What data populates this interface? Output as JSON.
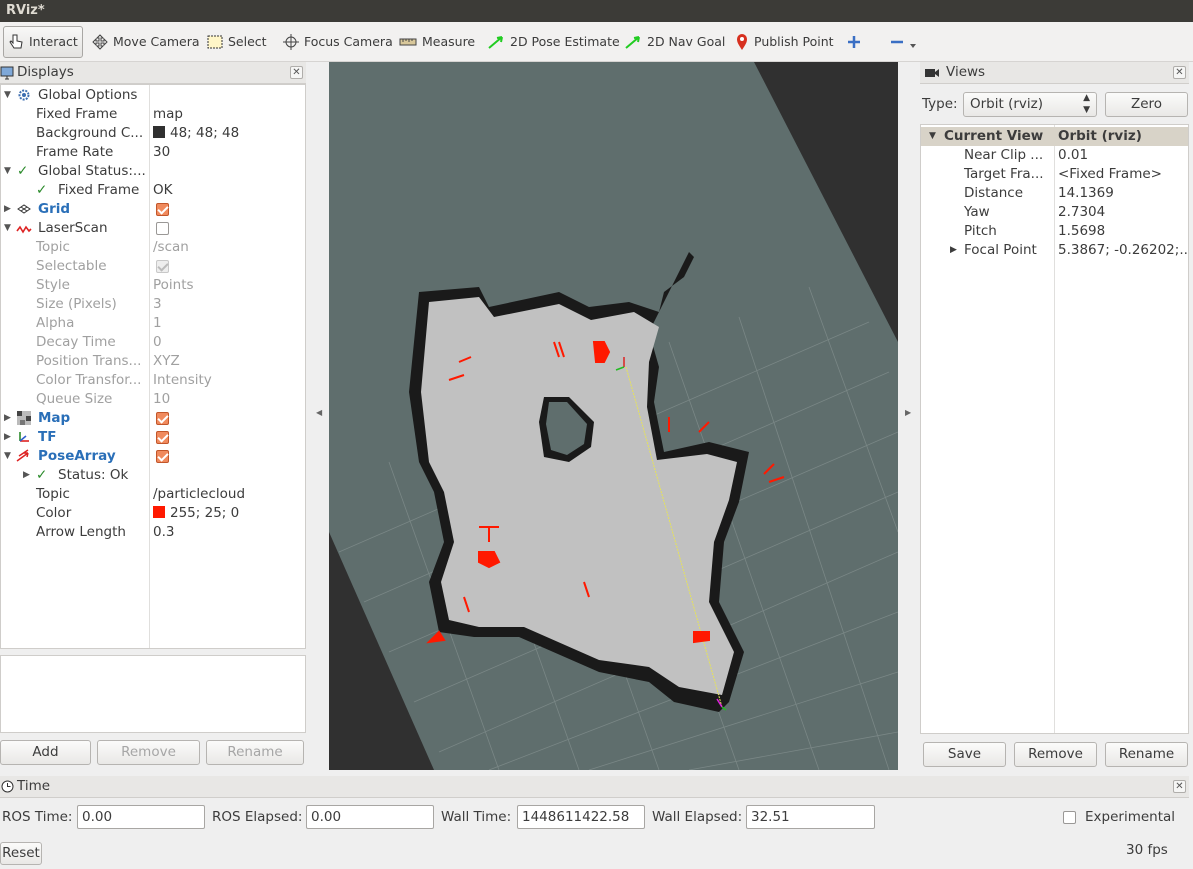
{
  "window": {
    "title": "RViz*"
  },
  "toolbar": {
    "interact": "Interact",
    "move_camera": "Move Camera",
    "select": "Select",
    "focus_camera": "Focus Camera",
    "measure": "Measure",
    "pose_estimate": "2D Pose Estimate",
    "nav_goal": "2D Nav Goal",
    "publish_point": "Publish Point"
  },
  "displays": {
    "title": "Displays",
    "rows": {
      "global_options": "Global Options",
      "fixed_frame": {
        "name": "Fixed Frame",
        "value": "map"
      },
      "background_color": {
        "name": "Background C...",
        "value": "48; 48; 48",
        "color": "#303030"
      },
      "frame_rate": {
        "name": "Frame Rate",
        "value": "30"
      },
      "global_status": "Global Status:...",
      "fixed_frame_status": {
        "name": "Fixed Frame",
        "value": "OK"
      },
      "grid": "Grid",
      "laserscan": "LaserScan",
      "topic": {
        "name": "Topic",
        "value": "/scan"
      },
      "selectable": "Selectable",
      "style": {
        "name": "Style",
        "value": "Points"
      },
      "size": {
        "name": "Size (Pixels)",
        "value": "3"
      },
      "alpha": {
        "name": "Alpha",
        "value": "1"
      },
      "decay": {
        "name": "Decay Time",
        "value": "0"
      },
      "position_transformer": {
        "name": "Position Trans...",
        "value": "XYZ"
      },
      "color_transformer": {
        "name": "Color Transfor...",
        "value": "Intensity"
      },
      "queue_size": {
        "name": "Queue Size",
        "value": "10"
      },
      "map": "Map",
      "tf": "TF",
      "posearray": "PoseArray",
      "status_ok": "Status: Ok",
      "pa_topic": {
        "name": "Topic",
        "value": "/particlecloud"
      },
      "pa_color": {
        "name": "Color",
        "value": "255; 25; 0",
        "color": "#ff1900"
      },
      "arrow_length": {
        "name": "Arrow Length",
        "value": "0.3"
      }
    },
    "buttons": {
      "add": "Add",
      "remove": "Remove",
      "rename": "Rename"
    }
  },
  "views": {
    "title": "Views",
    "type_label": "Type:",
    "type_value": "Orbit (rviz)",
    "zero": "Zero",
    "header": {
      "name": "Current View",
      "value": "Orbit (rviz)"
    },
    "rows": [
      {
        "name": "Near Clip ...",
        "value": "0.01"
      },
      {
        "name": "Target Fra...",
        "value": "<Fixed Frame>"
      },
      {
        "name": "Distance",
        "value": "14.1369"
      },
      {
        "name": "Yaw",
        "value": "2.7304"
      },
      {
        "name": "Pitch",
        "value": "1.5698"
      },
      {
        "name": "Focal Point",
        "value": "5.3867; -0.26202;..."
      }
    ],
    "buttons": {
      "save": "Save",
      "remove": "Remove",
      "rename": "Rename"
    }
  },
  "time": {
    "title": "Time",
    "ros_time_label": "ROS Time:",
    "ros_time": "0.00",
    "ros_elapsed_label": "ROS Elapsed:",
    "ros_elapsed": "0.00",
    "wall_time_label": "Wall Time:",
    "wall_time": "1448611422.58",
    "wall_elapsed_label": "Wall Elapsed:",
    "wall_elapsed": "32.51",
    "experimental": "Experimental",
    "reset": "Reset",
    "fps": "30 fps"
  },
  "colors": {
    "grid_plane": "#5f6e6d",
    "map_free": "#c1c1c1",
    "map_occupied": "#1a1a1a",
    "particles": "#ff1900"
  }
}
